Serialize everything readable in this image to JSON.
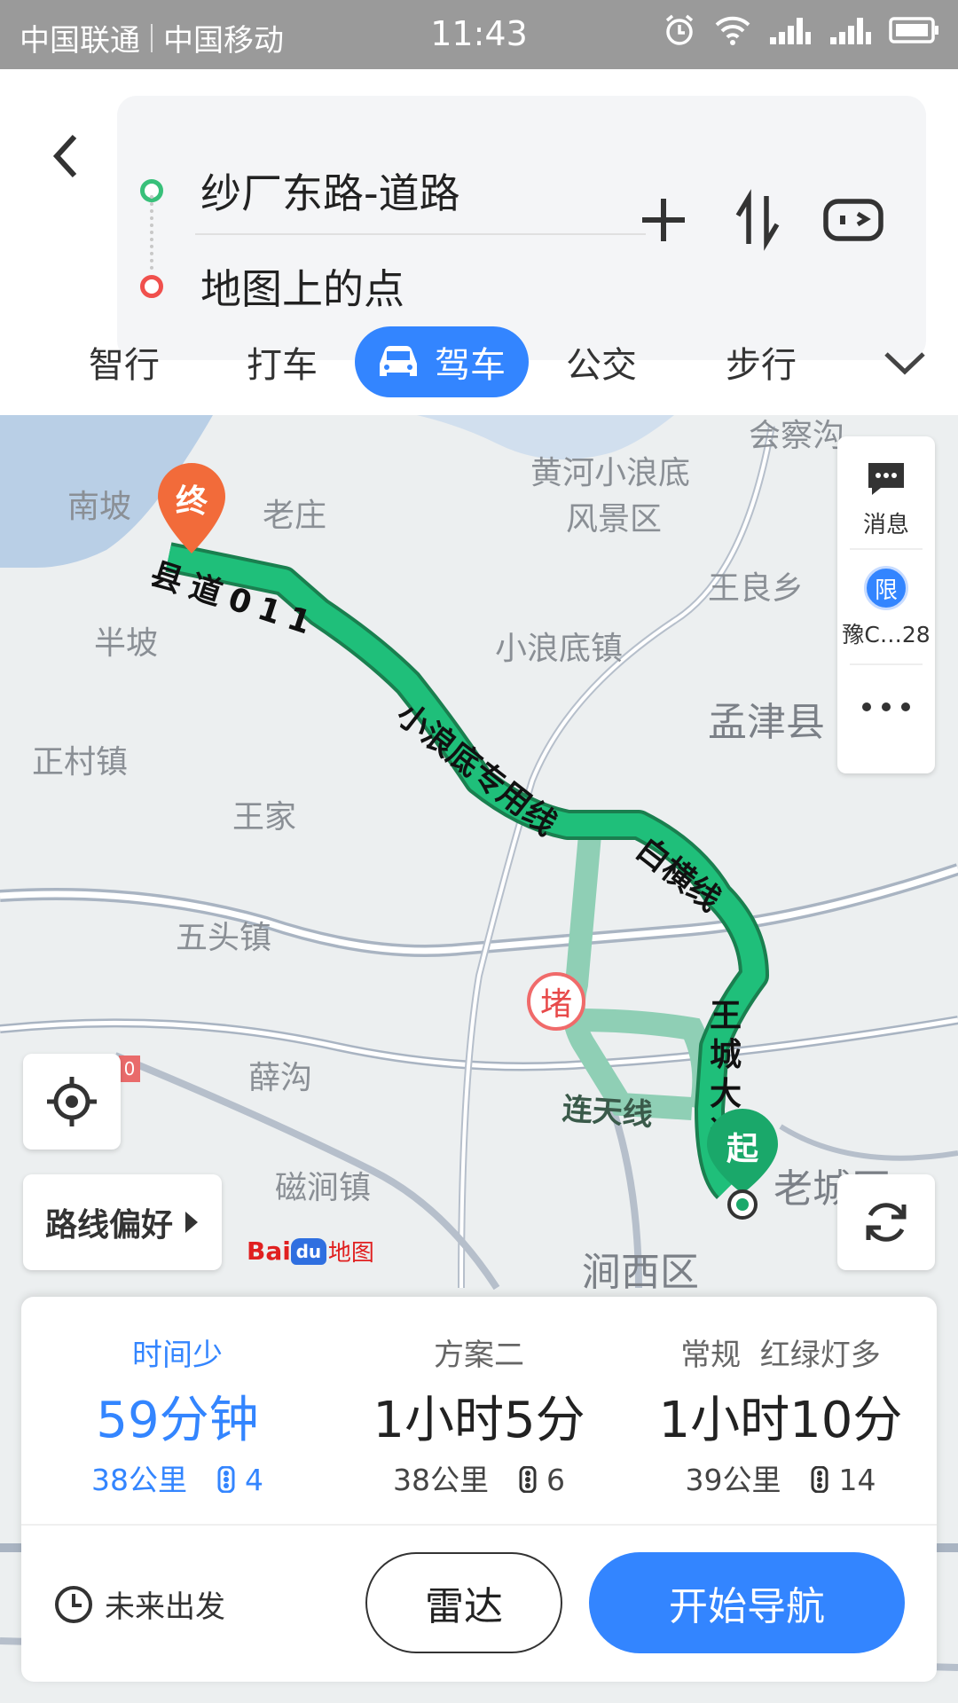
{
  "status_bar": {
    "carrier1": "中国联通",
    "carrier2": "中国移动",
    "time": "11:43"
  },
  "route": {
    "start": "纱厂东路-道路",
    "end": "地图上的点"
  },
  "tabs": [
    {
      "label": "智行"
    },
    {
      "label": "打车"
    },
    {
      "label": "驾车",
      "active": true
    },
    {
      "label": "公交"
    },
    {
      "label": "步行"
    }
  ],
  "map": {
    "places": {
      "nanpo": "南坡",
      "laozhuang": "老庄",
      "huanghe": "黄河小浪底",
      "fengjingqu": "风景区",
      "huicha": "会察沟",
      "wangliang": "王良乡",
      "banpo": "半坡",
      "xiaolangdi": "小浪底镇",
      "mengjin": "孟津县",
      "zhengcun": "正村镇",
      "wangjia": "王家",
      "wutou": "五头镇",
      "xuegou": "薛沟",
      "cijian": "磁涧镇",
      "jianxi": "涧西区",
      "laocheng": "老城区"
    },
    "route_labels": {
      "county_road": "县道011",
      "xiaolangdi_line": "小浪底专用线",
      "baiheng": "白横线",
      "wangcheng": "王城大道",
      "liantian": "连天线"
    },
    "markers": {
      "end": "终",
      "start": "起",
      "jam": "堵"
    },
    "road_badge": "0",
    "side_panel": {
      "message": "消息",
      "restrict_icon": "限",
      "plate": "豫C…28"
    },
    "route_pref": "路线偏好",
    "logo_bai": "Bai",
    "logo_du": "du",
    "logo_map": "地图"
  },
  "plans": [
    {
      "label": "时间少",
      "time": "59分钟",
      "distance": "38公里",
      "lights": "4",
      "selected": true
    },
    {
      "label": "方案二",
      "time": "1小时5分",
      "distance": "38公里",
      "lights": "6"
    },
    {
      "label": "常规  红绿灯多",
      "time": "1小时10分",
      "distance": "39公里",
      "lights": "14"
    }
  ],
  "actions": {
    "future": "未来出发",
    "radar": "雷达",
    "navigate": "开始导航"
  },
  "colors": {
    "accent": "#3385ff",
    "route_primary": "#1aa86a",
    "route_alt": "#8fcfb5",
    "end_marker": "#f26b3a",
    "start_marker": "#1aa86a"
  }
}
